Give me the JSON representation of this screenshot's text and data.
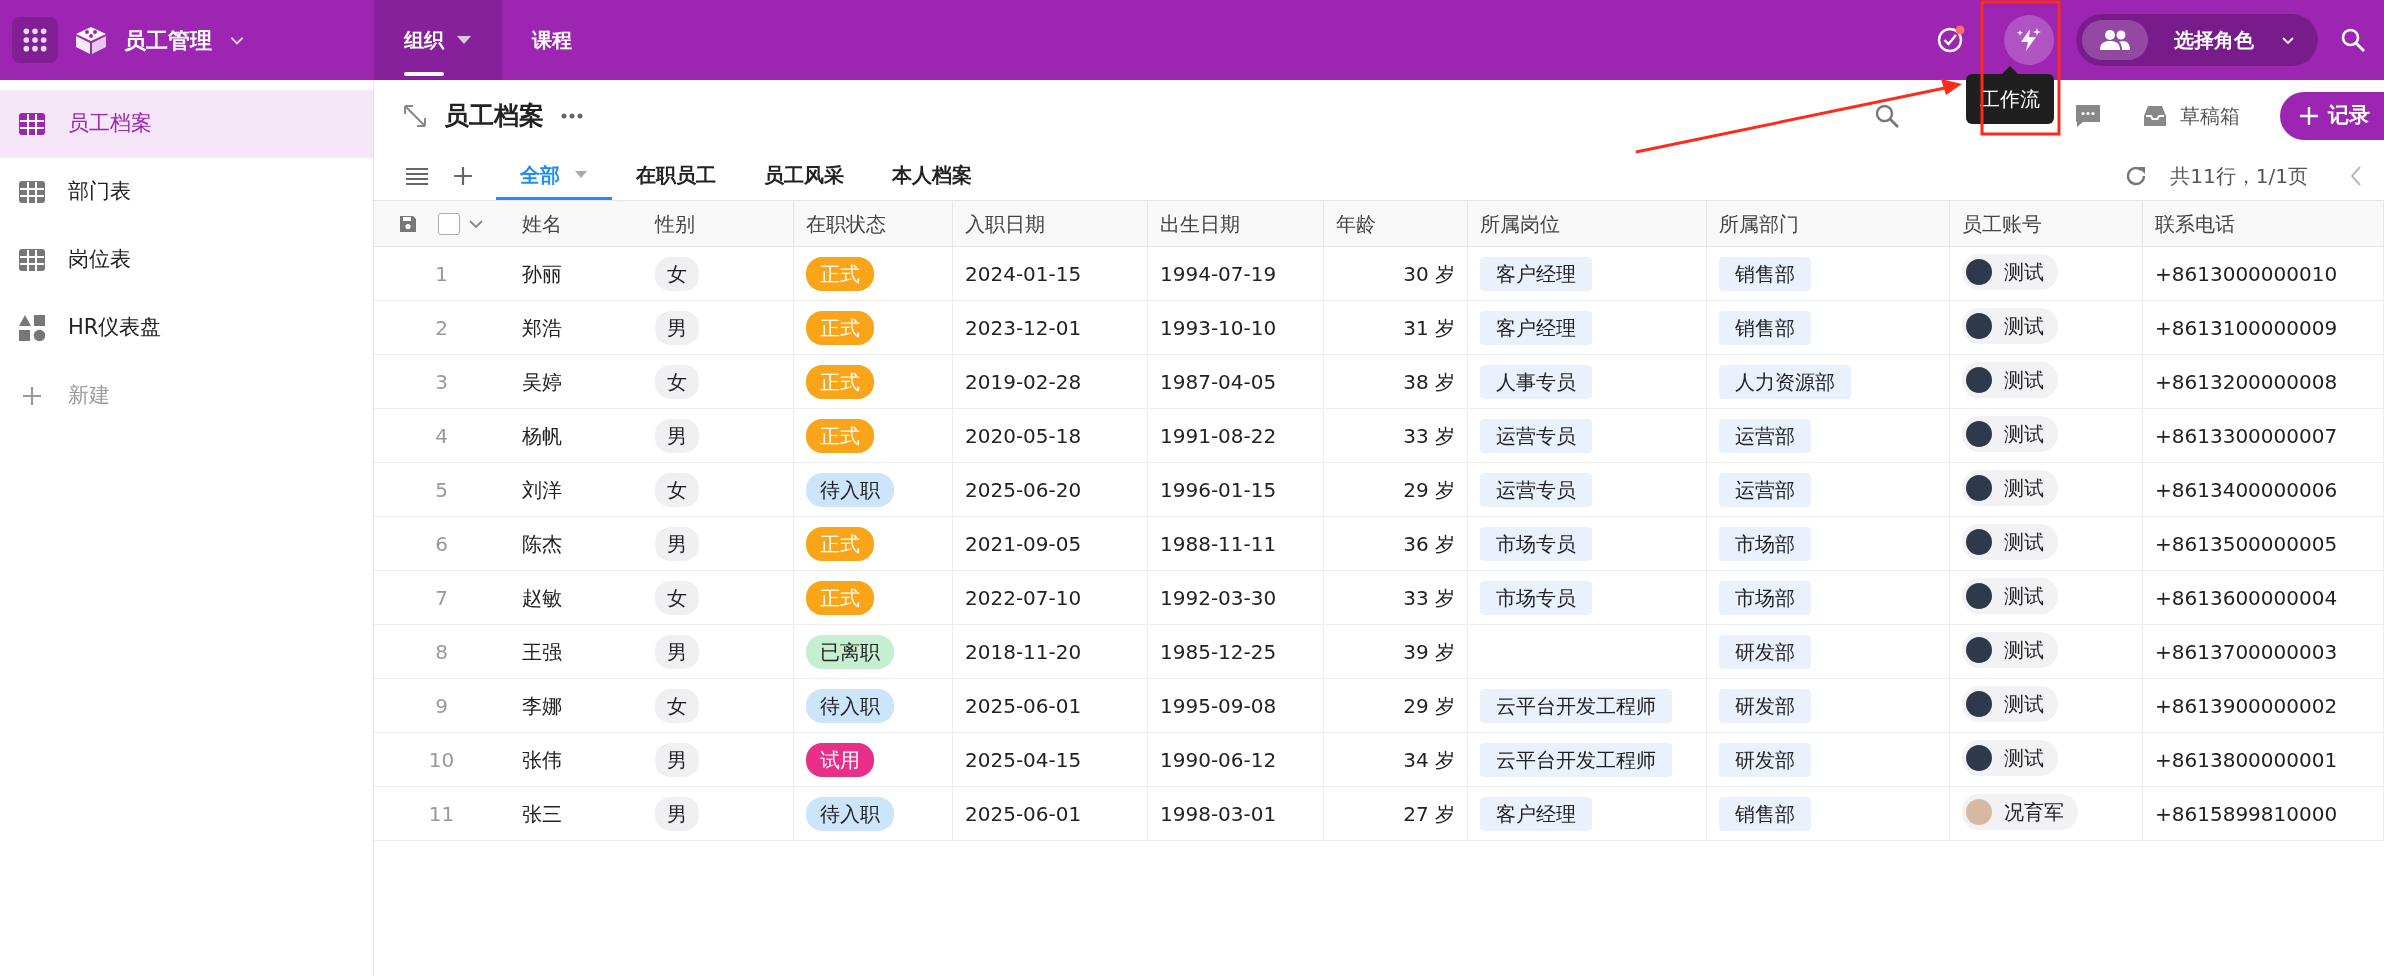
{
  "app": {
    "title": "员工管理"
  },
  "top_tabs": [
    {
      "label": "组织",
      "selected": true,
      "has_menu": true
    },
    {
      "label": "课程",
      "selected": false,
      "has_menu": false
    }
  ],
  "notifications": {
    "unread": true
  },
  "tooltip": "工作流",
  "role_selector": {
    "label": "选择角色"
  },
  "sidebar": {
    "items": [
      {
        "label": "员工档案",
        "selected": true,
        "kind": "table"
      },
      {
        "label": "部门表",
        "selected": false,
        "kind": "table"
      },
      {
        "label": "岗位表",
        "selected": false,
        "kind": "table"
      },
      {
        "label": "HR仪表盘",
        "selected": false,
        "kind": "dashboard"
      }
    ],
    "new_label": "新建"
  },
  "page": {
    "title": "员工档案",
    "drafts_label": "草稿箱",
    "add_record_label": "记录"
  },
  "views": [
    {
      "label": "全部",
      "selected": true,
      "has_menu": true
    },
    {
      "label": "在职员工",
      "selected": false,
      "has_menu": false
    },
    {
      "label": "员工风采",
      "selected": false,
      "has_menu": false
    },
    {
      "label": "本人档案",
      "selected": false,
      "has_menu": false
    }
  ],
  "pagination": "共11行，1/1页",
  "select_all": {
    "checked": false
  },
  "table": {
    "columns": [
      "姓名",
      "性别",
      "在职状态",
      "入职日期",
      "出生日期",
      "年龄",
      "所属岗位",
      "所属部门",
      "员工账号",
      "联系电话"
    ],
    "rows": [
      {
        "index": "1",
        "name": "孙丽",
        "gender": "女",
        "status": {
          "label": "正式",
          "color": "#faa519"
        },
        "hire_date": "2024-01-15",
        "birth_date": "1994-07-19",
        "age": "30 岁",
        "post": "客户经理",
        "dept": "销售部",
        "account": {
          "name": "测试",
          "has_photo": false
        },
        "phone": "+8613000000010"
      },
      {
        "index": "2",
        "name": "郑浩",
        "gender": "男",
        "status": {
          "label": "正式",
          "color": "#faa519"
        },
        "hire_date": "2023-12-01",
        "birth_date": "1993-10-10",
        "age": "31 岁",
        "post": "客户经理",
        "dept": "销售部",
        "account": {
          "name": "测试",
          "has_photo": false
        },
        "phone": "+8613100000009"
      },
      {
        "index": "3",
        "name": "吴婷",
        "gender": "女",
        "status": {
          "label": "正式",
          "color": "#faa519"
        },
        "hire_date": "2019-02-28",
        "birth_date": "1987-04-05",
        "age": "38 岁",
        "post": "人事专员",
        "dept": "人力资源部",
        "account": {
          "name": "测试",
          "has_photo": false
        },
        "phone": "+8613200000008"
      },
      {
        "index": "4",
        "name": "杨帆",
        "gender": "男",
        "status": {
          "label": "正式",
          "color": "#faa519"
        },
        "hire_date": "2020-05-18",
        "birth_date": "1991-08-22",
        "age": "33 岁",
        "post": "运营专员",
        "dept": "运营部",
        "account": {
          "name": "测试",
          "has_photo": false
        },
        "phone": "+8613300000007"
      },
      {
        "index": "5",
        "name": "刘洋",
        "gender": "女",
        "status": {
          "label": "待入职",
          "color": "#cce5fb"
        },
        "hire_date": "2025-06-20",
        "birth_date": "1996-01-15",
        "age": "29 岁",
        "post": "运营专员",
        "dept": "运营部",
        "account": {
          "name": "测试",
          "has_photo": false
        },
        "phone": "+8613400000006"
      },
      {
        "index": "6",
        "name": "陈杰",
        "gender": "男",
        "status": {
          "label": "正式",
          "color": "#faa519"
        },
        "hire_date": "2021-09-05",
        "birth_date": "1988-11-11",
        "age": "36 岁",
        "post": "市场专员",
        "dept": "市场部",
        "account": {
          "name": "测试",
          "has_photo": false
        },
        "phone": "+8613500000005"
      },
      {
        "index": "7",
        "name": "赵敏",
        "gender": "女",
        "status": {
          "label": "正式",
          "color": "#faa519"
        },
        "hire_date": "2022-07-10",
        "birth_date": "1992-03-30",
        "age": "33 岁",
        "post": "市场专员",
        "dept": "市场部",
        "account": {
          "name": "测试",
          "has_photo": false
        },
        "phone": "+8613600000004"
      },
      {
        "index": "8",
        "name": "王强",
        "gender": "男",
        "status": {
          "label": "已离职",
          "color": "#c6efd2"
        },
        "hire_date": "2018-11-20",
        "birth_date": "1985-12-25",
        "age": "39 岁",
        "dept": "研发部",
        "account": {
          "name": "测试",
          "has_photo": false
        },
        "phone": "+8613700000003"
      },
      {
        "index": "9",
        "name": "李娜",
        "gender": "女",
        "status": {
          "label": "待入职",
          "color": "#cce5fb"
        },
        "hire_date": "2025-06-01",
        "birth_date": "1995-09-08",
        "age": "29 岁",
        "post": "云平台开发工程师",
        "dept": "研发部",
        "account": {
          "name": "测试",
          "has_photo": false
        },
        "phone": "+8613900000002"
      },
      {
        "index": "10",
        "name": "张伟",
        "gender": "男",
        "status": {
          "label": "试用",
          "color": "#e8308a"
        },
        "hire_date": "2025-04-15",
        "birth_date": "1990-06-12",
        "age": "34 岁",
        "post": "云平台开发工程师",
        "dept": "研发部",
        "account": {
          "name": "测试",
          "has_photo": false
        },
        "phone": "+8613800000001"
      },
      {
        "index": "11",
        "name": "张三",
        "gender": "男",
        "status": {
          "label": "待入职",
          "color": "#cce5fb"
        },
        "hire_date": "2025-06-01",
        "birth_date": "1998-03-01",
        "age": "27 岁",
        "post": "客户经理",
        "dept": "销售部",
        "account": {
          "name": "况育军",
          "has_photo": true
        },
        "phone": "+8615899810000"
      }
    ]
  }
}
